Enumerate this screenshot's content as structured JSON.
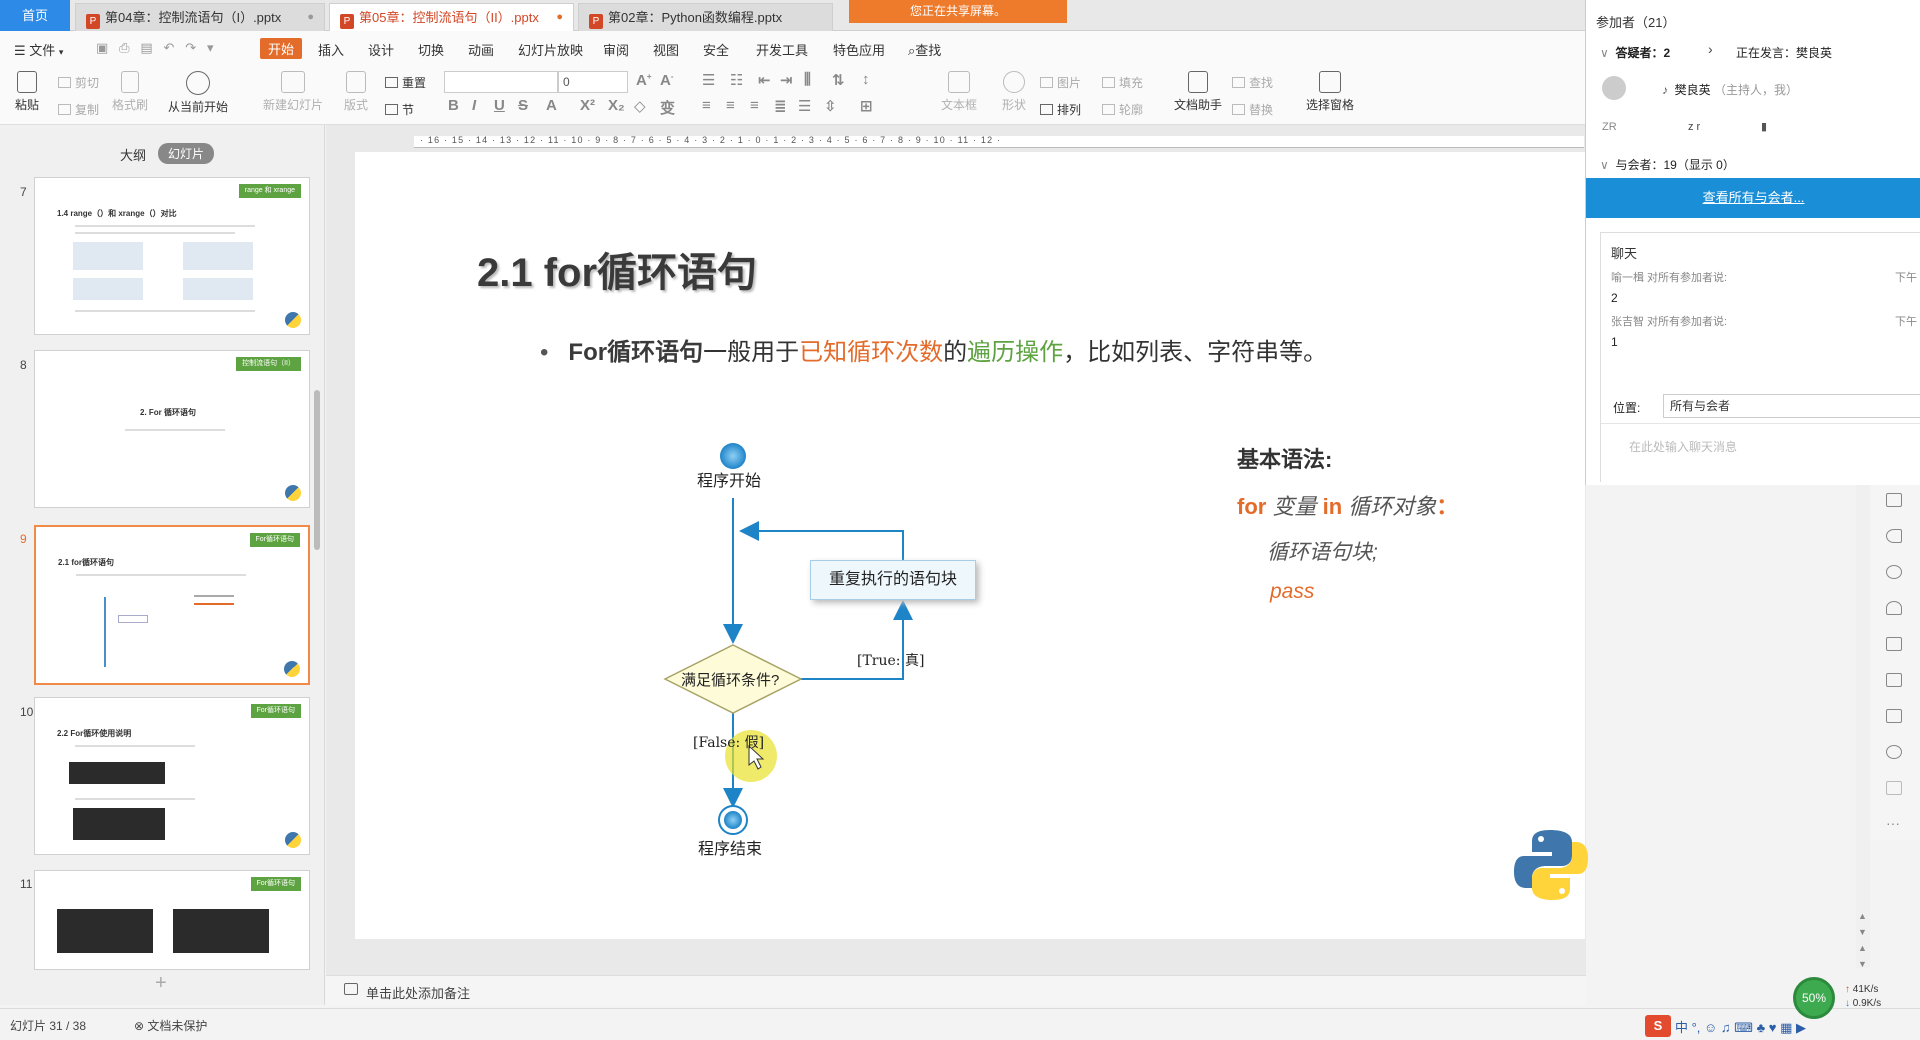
{
  "tabs": {
    "home": "首页",
    "items": [
      {
        "label": "第04章：控制流语句（I）.pptx"
      },
      {
        "label": "第05章：控制流语句（II）.pptx"
      },
      {
        "label": "第02章：Python函数编程.pptx"
      }
    ]
  },
  "share_banner": "您正在共享屏幕。",
  "menu": {
    "file": "文件",
    "start": "开始",
    "items": [
      "插入",
      "设计",
      "切换",
      "动画",
      "幻灯片放映",
      "审阅",
      "视图",
      "安全",
      "开发工具",
      "特色应用"
    ],
    "search": "查找"
  },
  "ribbon": {
    "paste": "粘贴",
    "cut": "剪切",
    "copy": "复制",
    "format_painter": "格式刷",
    "play_from_current": "从当前开始",
    "new_slide": "新建幻灯片",
    "layout": "版式",
    "reset": "重置",
    "section": "节",
    "font_size": "0",
    "text_box": "文本框",
    "shape": "形状",
    "picture": "图片",
    "arrange": "排列",
    "fill": "填充",
    "outline": "轮廓",
    "doc_assistant": "文档助手",
    "find": "查找",
    "replace": "替换",
    "select_pane": "选择窗格"
  },
  "left_panel": {
    "tab_outline": "大纲",
    "tab_slides": "幻灯片",
    "thumbs": [
      {
        "num": "7",
        "tag": "range 和 xrange",
        "title": "1.4 range（）和 xrange（）对比"
      },
      {
        "num": "8",
        "tag": "控制流语句（II）",
        "title": "2. For 循环语句"
      },
      {
        "num": "9",
        "tag": "For循环语句",
        "title": "2.1 for循环语句"
      },
      {
        "num": "10",
        "tag": "For循环语句",
        "title": "2.2 For循环使用说明"
      },
      {
        "num": "11",
        "tag": "For循环语句",
        "title": ""
      }
    ],
    "add": "+"
  },
  "slide": {
    "title": "2.1 for循环语句",
    "bullet": {
      "b1": "For循环语句",
      "b2": "一般用于",
      "b3": "已知循环次数",
      "b4": "的",
      "b5": "遍历操作",
      "b6": "，比如列表、字符串等。"
    },
    "flow": {
      "start": "程序开始",
      "repeat": "重复执行的语句块",
      "cond": "满足循环条件?",
      "true": "[True: 真]",
      "false": "[False: 假]",
      "end": "程序结束"
    },
    "syntax": {
      "heading": "基本语法:",
      "kw_for": "for",
      "var": "变量",
      "kw_in": "in",
      "obj": "循环对象",
      "colon": "：",
      "block": "循环语句块;",
      "pass": "pass"
    }
  },
  "ruler_text": "· 16 · 15 · 14 · 13 · 12 · 11 · 10 · 9 · 8 · 7 · 6 · 5 · 4 · 3 · 2 · 1 · 0 · 1 · 2 · 3 · 4 · 5 · 6 · 7 · 8 · 9 · 10 · 11 · 12 ·",
  "notes": "单击此处添加备注",
  "status": {
    "slide_info": "幻灯片 31 / 38",
    "protect": "文档未保护"
  },
  "meeting": {
    "participants": "参加者（21）",
    "questioner": "答疑者：2",
    "speaking": "正在发言：",
    "speaker": "樊良英",
    "host_name": "樊良英",
    "host_role": "（主持人，我）",
    "zr_initials": "ZR",
    "zr_name": "z r",
    "attendees": "与会者：19（显示 0）",
    "view_all": "查看所有与会者...",
    "chat_title": "聊天",
    "messages": [
      {
        "sender": "喻一楫 对所有参加者说:",
        "time": "下午",
        "text": "2"
      },
      {
        "sender": "张吉智 对所有参加者说:",
        "time": "下午",
        "text": "1"
      }
    ],
    "to_label": "位置:",
    "to_value": "所有与会者",
    "input_placeholder": "在此处输入聊天消息"
  },
  "tray": {
    "percent": "50%",
    "up_speed": "41K/s",
    "down_speed": "0.9K/s"
  },
  "colors": {
    "accent_orange": "#e36c2b",
    "accent_green": "#5ea341",
    "tab_active": "#d24726",
    "meeting_blue": "#1a8fd8"
  }
}
